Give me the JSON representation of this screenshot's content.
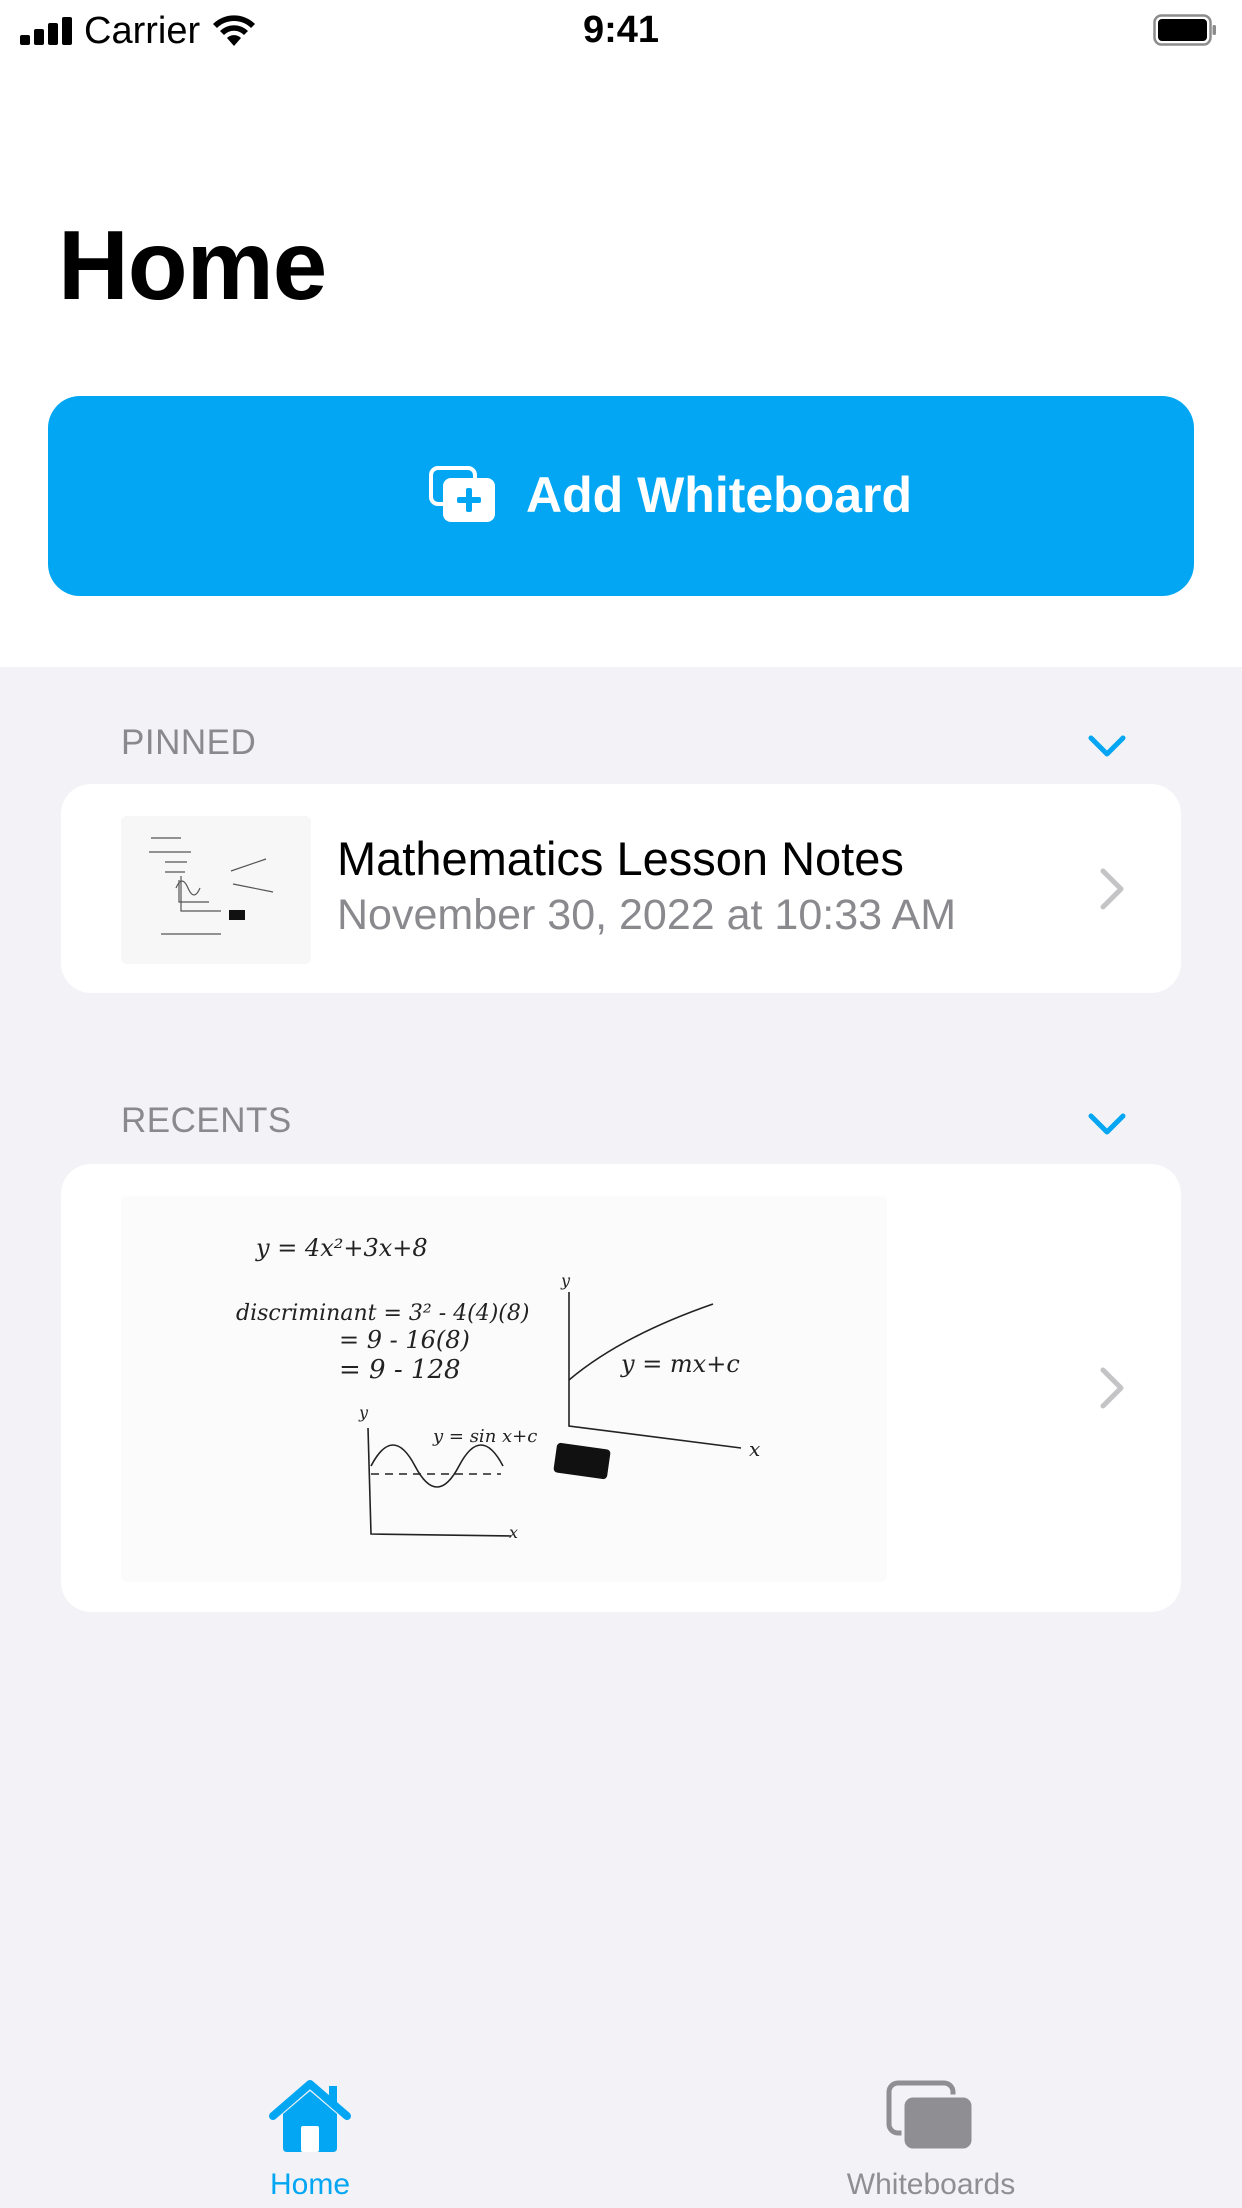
{
  "status_bar": {
    "carrier": "Carrier",
    "time": "9:41"
  },
  "page": {
    "title": "Home"
  },
  "add_button": {
    "label": "Add Whiteboard",
    "icon": "add-whiteboard-icon",
    "color": "#02a6f2"
  },
  "sections": {
    "pinned": {
      "header": "PINNED",
      "items": [
        {
          "title": "Mathematics Lesson Notes",
          "date": "November 30, 2022 at 10:33 AM"
        }
      ]
    },
    "recents": {
      "header": "RECENTS"
    }
  },
  "whiteboard_notes": {
    "eq1": "y = 4x²+3x+8",
    "disc1": "discriminant = 3² - 4(4)(8)",
    "disc2": "= 9 - 16(8)",
    "disc3": "= 9 - 128",
    "line_label": "y = mx+c",
    "sine_label": "y = sin x+c",
    "axis_x": "x",
    "axis_y": "y"
  },
  "tab_bar": {
    "tabs": [
      {
        "label": "Home",
        "icon": "house-icon",
        "active": true
      },
      {
        "label": "Whiteboards",
        "icon": "stacked-boards-icon",
        "active": false
      }
    ],
    "active_color": "#02a6f2",
    "inactive_color": "#8e8e93"
  }
}
